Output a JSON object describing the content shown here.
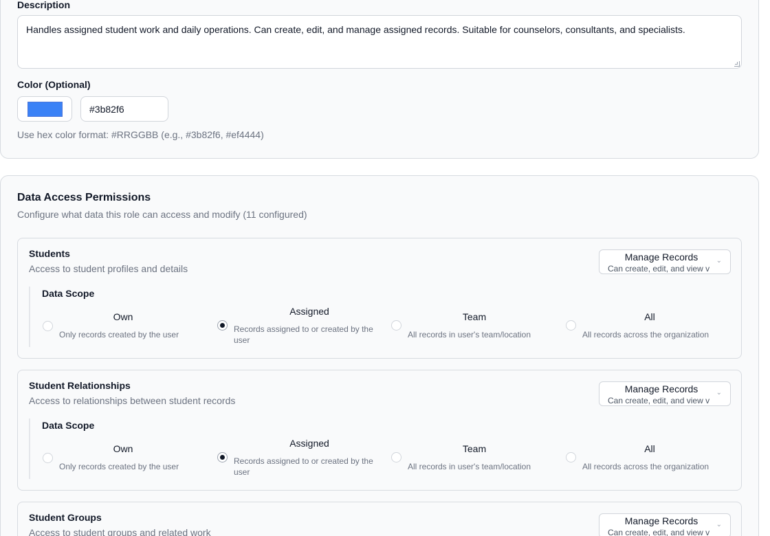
{
  "form": {
    "description_label": "Description",
    "description_value": "Handles assigned student work and daily operations. Can create, edit, and manage assigned records. Suitable for counselors, consultants, and specialists.",
    "color_label": "Color (Optional)",
    "color_value": "#3b82f6",
    "color_hint": "Use hex color format: #RRGGBB (e.g., #3b82f6, #ef4444)"
  },
  "permissions": {
    "title": "Data Access Permissions",
    "subtitle": "Configure what data this role can access and modify (11 configured)",
    "scope_label": "Data Scope",
    "options": [
      {
        "title": "Own",
        "desc": "Only records created by the user"
      },
      {
        "title": "Assigned",
        "desc": "Records assigned to or created by the user"
      },
      {
        "title": "Team",
        "desc": "All records in user's team/location"
      },
      {
        "title": "All",
        "desc": "All records across the organization"
      }
    ],
    "resources": [
      {
        "name": "Students",
        "desc": "Access to student profiles and details",
        "access": "Manage Records",
        "access_sub": "Can create, edit, and view v",
        "selected_scope": "Assigned"
      },
      {
        "name": "Student Relationships",
        "desc": "Access to relationships between student records",
        "access": "Manage Records",
        "access_sub": "Can create, edit, and view v",
        "selected_scope": "Assigned"
      },
      {
        "name": "Student Groups",
        "desc": "Access to student groups and related work",
        "access": "Manage Records",
        "access_sub": "Can create, edit, and view v"
      }
    ]
  },
  "colors": {
    "accent": "#3b82f6",
    "border": "#d7dbe0",
    "muted": "#6b7280"
  }
}
